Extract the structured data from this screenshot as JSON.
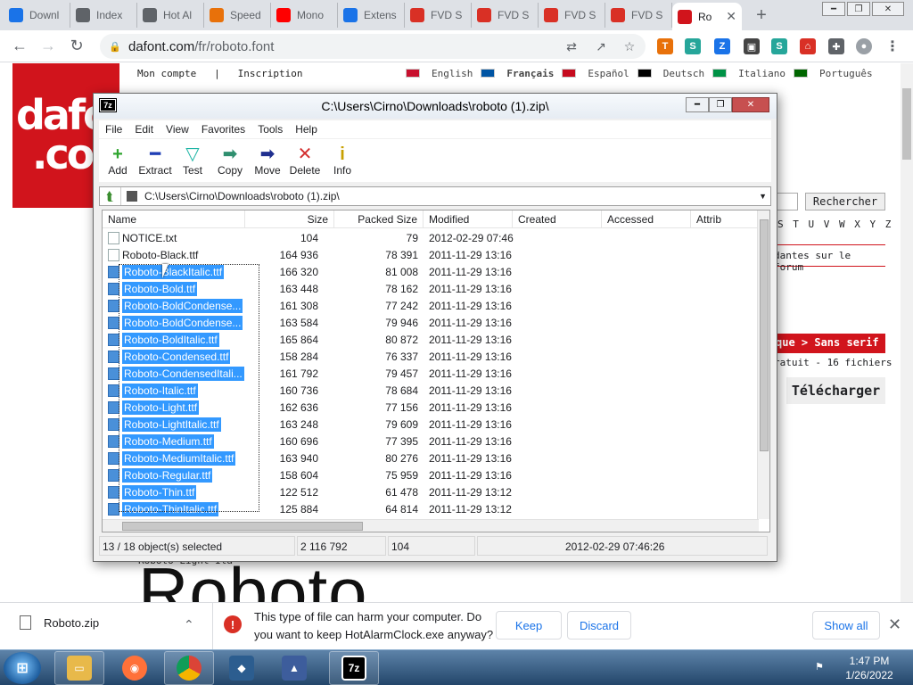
{
  "tabs": [
    {
      "label": "Downl",
      "icon": "chrome-downloads-icon",
      "color": "#1a73e8",
      "active": false
    },
    {
      "label": "Index",
      "icon": "globe-icon",
      "color": "#5f6368",
      "active": false
    },
    {
      "label": "Hot Al",
      "icon": "clock-icon",
      "color": "#5f6368",
      "active": false
    },
    {
      "label": "Speed",
      "icon": "speed-icon",
      "color": "#e8710a",
      "active": false
    },
    {
      "label": "Mono",
      "icon": "youtube-icon",
      "color": "#ff0000",
      "active": false
    },
    {
      "label": "Extens",
      "icon": "puzzle-icon",
      "color": "#1a73e8",
      "active": false
    },
    {
      "label": "FVD S",
      "icon": "house-icon",
      "color": "#d93025",
      "active": false
    },
    {
      "label": "FVD S",
      "icon": "house-icon",
      "color": "#d93025",
      "active": false
    },
    {
      "label": "FVD S",
      "icon": "house-icon",
      "color": "#d93025",
      "active": false
    },
    {
      "label": "FVD S",
      "icon": "house-icon",
      "color": "#d93025",
      "active": false
    },
    {
      "label": "Ro",
      "icon": "dafont-favicon",
      "color": "#d1141c",
      "active": true
    }
  ],
  "toolbar": {
    "url_host": "dafont.com",
    "url_path": "/fr/roboto.font"
  },
  "page": {
    "logo_text_1": "dafon",
    "logo_text_2": ".com",
    "account": "Mon compte",
    "separator": "|",
    "signup": "Inscription",
    "languages": [
      "English",
      "Français",
      "Español",
      "Deutsch",
      "Italiano",
      "Português"
    ],
    "search_button": "Rechercher",
    "alphabet": "S T U V W X Y Z #",
    "forum_text": "dantes sur le forum",
    "category": "que > Sans serif",
    "free_text": "ratuit - 16 fichiers",
    "download": "Télécharger",
    "font_sub": "Roboto Light Ita",
    "font_big": "Roboto"
  },
  "sevenzip": {
    "title": "C:\\Users\\Cirno\\Downloads\\roboto (1).zip\\",
    "logo": "7z",
    "menu": [
      "File",
      "Edit",
      "View",
      "Favorites",
      "Tools",
      "Help"
    ],
    "tools": [
      {
        "label": "Add",
        "icon": "plus-icon",
        "glyph": "+",
        "color": "#2fa52f"
      },
      {
        "label": "Extract",
        "icon": "minus-icon",
        "glyph": "━",
        "color": "#1f3fb5"
      },
      {
        "label": "Test",
        "icon": "check-icon",
        "glyph": "▽",
        "color": "#1fb5a5"
      },
      {
        "label": "Copy",
        "icon": "copy-arrow-icon",
        "glyph": "➡",
        "color": "#2f8f6f"
      },
      {
        "label": "Move",
        "icon": "move-arrow-icon",
        "glyph": "➡",
        "color": "#1f2f8f"
      },
      {
        "label": "Delete",
        "icon": "delete-x-icon",
        "glyph": "✕",
        "color": "#d32f2f"
      },
      {
        "label": "Info",
        "icon": "info-icon",
        "glyph": "i",
        "color": "#c8a000"
      }
    ],
    "path": "C:\\Users\\Cirno\\Downloads\\roboto (1).zip\\",
    "columns": [
      "Name",
      "Size",
      "Packed Size",
      "Modified",
      "Created",
      "Accessed",
      "Attrib"
    ],
    "files": [
      {
        "name": "NOTICE.txt",
        "size": "104",
        "packed": "79",
        "modified": "2012-02-29 07:46",
        "selected": false
      },
      {
        "name": "Roboto-Black.ttf",
        "size": "164 936",
        "packed": "78 391",
        "modified": "2011-11-29 13:16",
        "selected": false
      },
      {
        "name": "Roboto-BlackItalic.ttf",
        "size": "166 320",
        "packed": "81 008",
        "modified": "2011-11-29 13:16",
        "selected": true
      },
      {
        "name": "Roboto-Bold.ttf",
        "size": "163 448",
        "packed": "78 162",
        "modified": "2011-11-29 13:16",
        "selected": true
      },
      {
        "name": "Roboto-BoldCondense...",
        "size": "161 308",
        "packed": "77 242",
        "modified": "2011-11-29 13:16",
        "selected": true
      },
      {
        "name": "Roboto-BoldCondense...",
        "size": "163 584",
        "packed": "79 946",
        "modified": "2011-11-29 13:16",
        "selected": true
      },
      {
        "name": "Roboto-BoldItalic.ttf",
        "size": "165 864",
        "packed": "80 872",
        "modified": "2011-11-29 13:16",
        "selected": true
      },
      {
        "name": "Roboto-Condensed.ttf",
        "size": "158 284",
        "packed": "76 337",
        "modified": "2011-11-29 13:16",
        "selected": true
      },
      {
        "name": "Roboto-CondensedItali...",
        "size": "161 792",
        "packed": "79 457",
        "modified": "2011-11-29 13:16",
        "selected": true
      },
      {
        "name": "Roboto-Italic.ttf",
        "size": "160 736",
        "packed": "78 684",
        "modified": "2011-11-29 13:16",
        "selected": true
      },
      {
        "name": "Roboto-Light.ttf",
        "size": "162 636",
        "packed": "77 156",
        "modified": "2011-11-29 13:16",
        "selected": true
      },
      {
        "name": "Roboto-LightItalic.ttf",
        "size": "163 248",
        "packed": "79 609",
        "modified": "2011-11-29 13:16",
        "selected": true
      },
      {
        "name": "Roboto-Medium.ttf",
        "size": "160 696",
        "packed": "77 395",
        "modified": "2011-11-29 13:16",
        "selected": true
      },
      {
        "name": "Roboto-MediumItalic.ttf",
        "size": "163 940",
        "packed": "80 276",
        "modified": "2011-11-29 13:16",
        "selected": true
      },
      {
        "name": "Roboto-Regular.ttf",
        "size": "158 604",
        "packed": "75 959",
        "modified": "2011-11-29 13:16",
        "selected": true
      },
      {
        "name": "Roboto-Thin.ttf",
        "size": "122 512",
        "packed": "61 478",
        "modified": "2011-11-29 13:12",
        "selected": true
      },
      {
        "name": "Roboto-ThinItalic.ttf",
        "size": "125 884",
        "packed": "64 814",
        "modified": "2011-11-29 13:12",
        "selected": true
      }
    ],
    "status": {
      "selection": "13 / 18 object(s) selected",
      "total_size": "2 116 792",
      "item_size": "104",
      "item_date": "2012-02-29 07:46:26"
    }
  },
  "download_bar": {
    "file": "Roboto.zip",
    "warning": "This type of file can harm your computer. Do you want to keep HotAlarmClock.exe anyway?",
    "keep": "Keep",
    "discard": "Discard",
    "show_all": "Show all"
  },
  "taskbar": {
    "time": "1:47 PM",
    "date": "1/26/2022",
    "apps": [
      "explorer",
      "firefox",
      "chrome",
      "virtualbox",
      "inkscape",
      "7zip"
    ]
  },
  "colors": {
    "dafont_red": "#d1141c",
    "selection_blue": "#3399ff",
    "chrome_blue": "#1a73e8",
    "warning_red": "#d93025"
  }
}
